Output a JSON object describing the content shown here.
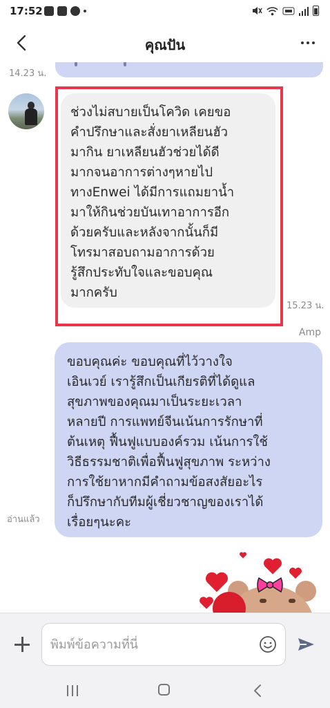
{
  "status_bar": {
    "time": "17:52",
    "icons": [
      "notification-l-icon",
      "image-icon",
      "line-icon",
      "dot-icon",
      "mute-icon",
      "wifi-icon",
      "volte-icon",
      "signal-icon",
      "battery-icon"
    ]
  },
  "header": {
    "title": "คุณปัน",
    "back_icon": "chevron-left-icon",
    "more_icon": "more-horizontal-icon"
  },
  "messages": {
    "previous_time": "14.23 น.",
    "incoming": {
      "text": "ช่วงไม่สบายเป็นโควิด เคยขอ\nคำปรึกษาและสั่งยาเหลียนฮัว\nมากิน ยาเหลียนฮัวช่วยได้ดี\nมากจนอาการต่างๆหายไป\nทางEnwei ได้มีการแถมยาน้ำ\nมาให้กินช่วยบันเทาอาการอีก\nด้วยครับและหลังจากนั้นก็มี\nโทรมาสอบถามอาการด้วย\nรู้สึกประทับใจและขอบคุณ\nมากครับ",
      "time": "15.23 น.",
      "highlight_color": "#e8364a"
    },
    "outgoing": {
      "sender": "Amp",
      "text": "ขอบคุณค่ะ ขอบคุณที่ไว้วางใจ\nเอินเวย์ เรารู้สึกเป็นเกียรติที่ได้ดูแล\nสุขภาพของคุณมาเป็นระยะเวลา\nหลายปี การแพทย์จีนเน้นการรักษาที่\nต้นเหตุ ฟื้นฟูแบบองค์รวม เน้นการใช้\nวิธีธรรมชาติเพื่อฟื้นฟูสุขภาพ ระหว่าง\nการใช้ยาหากมีคำถามข้อสงสัยอะไร\nก็ปรึกษากับทีมผู้เชี่ยวชาญของเราได้\nเรื่อยๆนะคะ",
      "read_label": "อ่านแล้ว",
      "bubble_color": "#cfd6f3"
    }
  },
  "input_bar": {
    "placeholder": "พิมพ์ข้อความที่นี่",
    "value": "",
    "plus_icon": "plus-icon",
    "emoji_icon": "emoji-icon",
    "send_icon": "send-icon"
  },
  "nav_bar": {
    "icons": [
      "recent-apps-icon",
      "home-icon",
      "back-icon"
    ]
  }
}
